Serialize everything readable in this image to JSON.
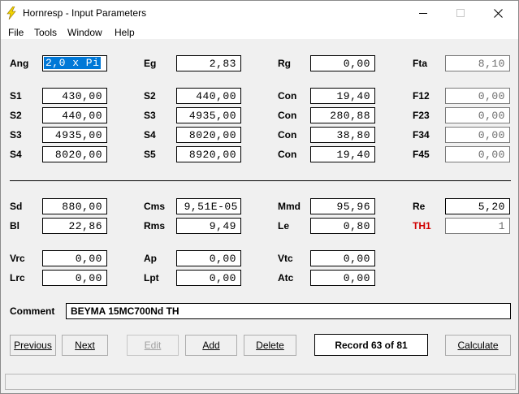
{
  "window": {
    "title": "Hornresp - Input Parameters"
  },
  "menu": [
    "File",
    "Tools",
    "Window",
    "Help"
  ],
  "labels": {
    "ang": "Ang",
    "eg": "Eg",
    "rg": "Rg",
    "fta": "Fta",
    "s1": "S1",
    "s2": "S2",
    "s3": "S3",
    "s4": "S4",
    "s5": "S5",
    "con": "Con",
    "f12": "F12",
    "f23": "F23",
    "f34": "F34",
    "f45": "F45",
    "sd": "Sd",
    "cms": "Cms",
    "mmd": "Mmd",
    "re": "Re",
    "bl": "Bl",
    "rms": "Rms",
    "le": "Le",
    "th1": "TH1",
    "vrc": "Vrc",
    "ap": "Ap",
    "vtc": "Vtc",
    "lrc": "Lrc",
    "lpt": "Lpt",
    "atc": "Atc",
    "comment": "Comment"
  },
  "values": {
    "ang": "2,0 x Pi",
    "eg": "2,83",
    "rg": "0,00",
    "fta": "8,10",
    "s1_a": "430,00",
    "s2_b": "440,00",
    "con1": "19,40",
    "f12": "0,00",
    "s2_a": "440,00",
    "s3_b": "4935,00",
    "con2": "280,88",
    "f23": "0,00",
    "s3_a": "4935,00",
    "s4_b": "8020,00",
    "con3": "38,80",
    "f34": "0,00",
    "s4_a": "8020,00",
    "s5_b": "8920,00",
    "con4": "19,40",
    "f45": "0,00",
    "sd": "880,00",
    "cms": "9,51E-05",
    "mmd": "95,96",
    "re": "5,20",
    "bl": "22,86",
    "rms": "9,49",
    "le": "0,80",
    "th1": "1",
    "vrc": "0,00",
    "ap": "0,00",
    "vtc": "0,00",
    "lrc": "0,00",
    "lpt": "0,00",
    "atc": "0,00",
    "comment": "BEYMA 15MC700Nd TH"
  },
  "buttons": {
    "previous": "Previous",
    "next": "Next",
    "edit": "Edit",
    "add": "Add",
    "delete": "Delete",
    "calculate": "Calculate"
  },
  "record": "Record 63 of 81",
  "colors": {
    "selection": "#0078d7",
    "th1_label": "#d00000"
  }
}
